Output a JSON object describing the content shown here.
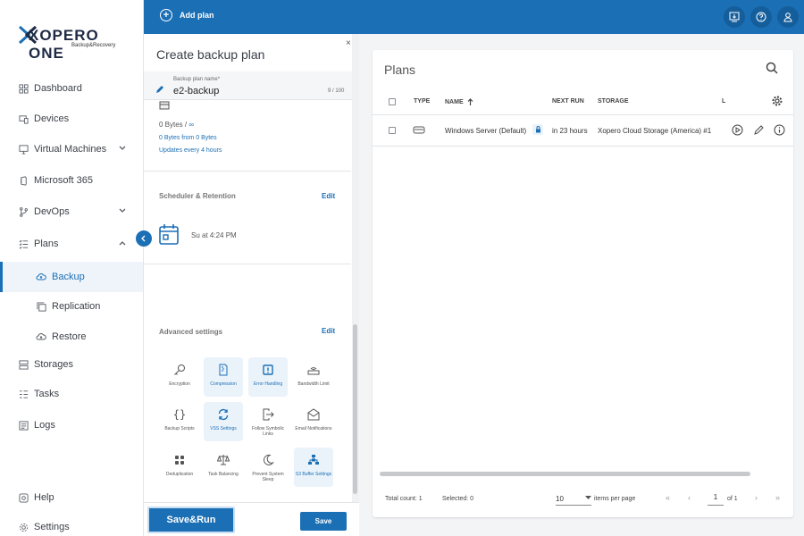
{
  "app": {
    "brand_name": "XOPERO ONE",
    "brand_sub": "Backup&Recovery"
  },
  "sidebar": {
    "items": [
      {
        "label": "Dashboard"
      },
      {
        "label": "Devices"
      },
      {
        "label": "Virtual Machines"
      },
      {
        "label": "Microsoft 365"
      },
      {
        "label": "DevOps"
      },
      {
        "label": "Plans"
      },
      {
        "label": "Backup"
      },
      {
        "label": "Replication"
      },
      {
        "label": "Restore"
      },
      {
        "label": "Storages"
      },
      {
        "label": "Tasks"
      },
      {
        "label": "Logs"
      },
      {
        "label": "Help"
      },
      {
        "label": "Settings"
      }
    ]
  },
  "topbar": {
    "add_plan_label": "Add plan"
  },
  "create_panel": {
    "title": "Create backup plan",
    "close_glyph": "×",
    "name_label": "Backup plan name*",
    "name_value": "e2-backup",
    "name_count": "9 / 100",
    "storage": {
      "bytes": "0 Bytes /",
      "infinity": "∞",
      "from": "0 Bytes from 0 Bytes",
      "updates": "Updates every 4 hours"
    },
    "scheduler": {
      "title": "Scheduler & Retention",
      "edit": "Edit",
      "schedule": "Su at 4:24 PM"
    },
    "advanced": {
      "title": "Advanced settings",
      "edit": "Edit",
      "items": [
        {
          "label": "Encryption"
        },
        {
          "label": "Compression"
        },
        {
          "label": "Error Handling"
        },
        {
          "label": "Bandwidth Limit"
        },
        {
          "label": "Backup Scripts"
        },
        {
          "label": "VSS Settings"
        },
        {
          "label": "Follow Symbolic Links"
        },
        {
          "label": "Email Notifications"
        },
        {
          "label": "Deduplication"
        },
        {
          "label": "Task Balancing"
        },
        {
          "label": "Prevent System Sleep"
        },
        {
          "label": "S3 Buffer Settings"
        }
      ]
    },
    "save_run_label": "Save&Run",
    "save_label": "Save"
  },
  "plans": {
    "title": "Plans",
    "columns": {
      "type": "TYPE",
      "name": "NAME",
      "next_run": "NEXT RUN",
      "storage": "STORAGE",
      "extra": "L"
    },
    "rows": [
      {
        "name": "Windows Server (Default)",
        "next_run": "in 23 hours",
        "storage": "Xopero Cloud Storage (America) #1"
      }
    ],
    "footer": {
      "total": "Total count: 1",
      "selected": "Selected: 0",
      "per_page_value": "10",
      "per_page_label": "items per page",
      "page": "1",
      "of": "of 1"
    }
  }
}
